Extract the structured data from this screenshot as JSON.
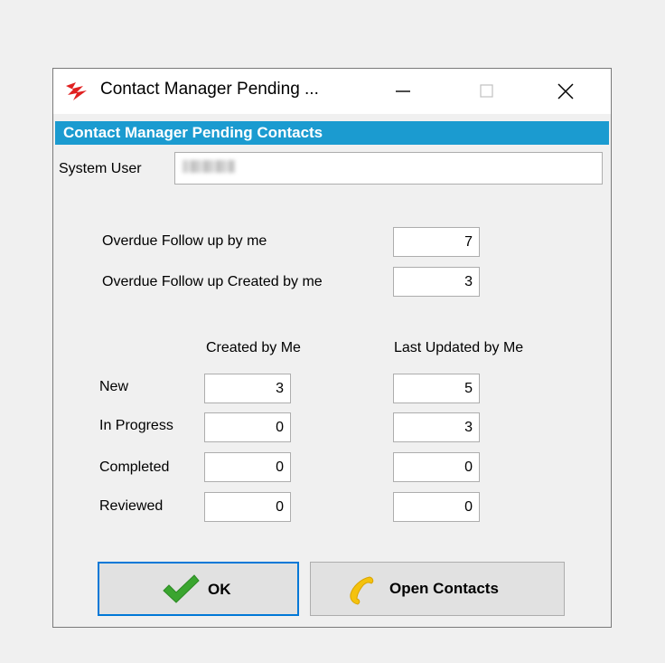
{
  "window": {
    "title": "Contact Manager Pending ...",
    "controls": {
      "minimize": "minimize-icon",
      "maximize": "maximize-icon",
      "close": "close-icon"
    }
  },
  "header": {
    "title": "Contact Manager Pending Contacts",
    "color": "#1b9bd0"
  },
  "system_user": {
    "label": "System User",
    "value": ""
  },
  "overdue": [
    {
      "label": "Overdue Follow up by me",
      "value": "7"
    },
    {
      "label": "Overdue Follow up Created by me",
      "value": "3"
    }
  ],
  "columns": {
    "created": "Created by Me",
    "updated": "Last Updated by Me"
  },
  "rows": [
    {
      "label": "New",
      "created": "3",
      "updated": "5"
    },
    {
      "label": "In Progress",
      "created": "0",
      "updated": "3"
    },
    {
      "label": "Completed",
      "created": "0",
      "updated": "0"
    },
    {
      "label": "Reviewed",
      "created": "0",
      "updated": "0"
    }
  ],
  "buttons": {
    "ok": {
      "label": "OK",
      "icon": "checkmark-icon"
    },
    "open_contacts": {
      "label": "Open Contacts",
      "icon": "phone-icon"
    }
  }
}
